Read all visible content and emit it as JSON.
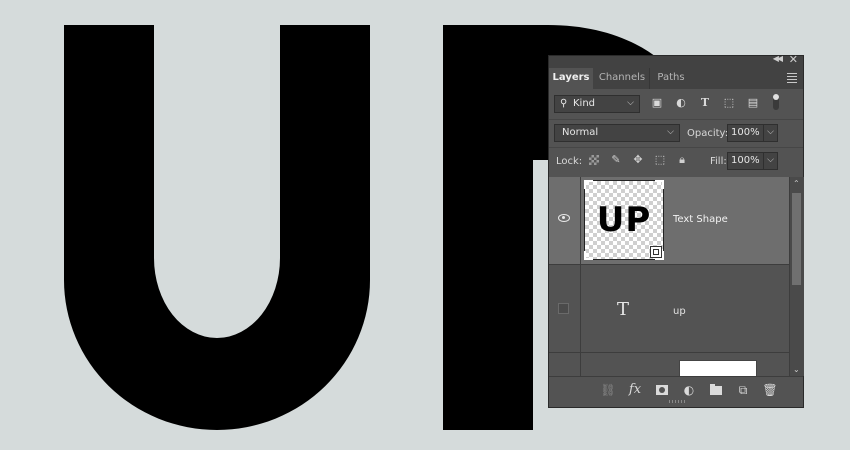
{
  "canvas": {
    "background": "#d5dbdb",
    "letters": [
      "U",
      "P"
    ],
    "letter_color": "#000000"
  },
  "panel": {
    "tabs": [
      {
        "label": "Layers",
        "active": true
      },
      {
        "label": "Channels",
        "active": false
      },
      {
        "label": "Paths",
        "active": false
      }
    ],
    "filter": {
      "kind_label": "Kind",
      "icons": [
        "image-filter-icon",
        "adjustment-filter-icon",
        "type-filter-icon",
        "shape-filter-icon",
        "smart-object-filter-icon",
        "filter-toggle"
      ]
    },
    "blend": {
      "mode": "Normal",
      "opacity_label": "Opacity:",
      "opacity_value": "100%"
    },
    "lock": {
      "label": "Lock:",
      "icons": [
        "lock-transparent-pixels-icon",
        "lock-image-pixels-icon",
        "lock-position-icon",
        "lock-artboard-icon",
        "lock-all-icon"
      ],
      "fill_label": "Fill:",
      "fill_value": "100%"
    },
    "layers": [
      {
        "name": "Text Shape",
        "visible": true,
        "selected": true,
        "thumb_text": "UP",
        "type": "smart-object"
      },
      {
        "name": "up",
        "visible": false,
        "selected": false,
        "type": "text",
        "type_glyph": "T"
      },
      {
        "name": "",
        "visible": false,
        "selected": false,
        "type": "fill"
      }
    ],
    "bottom_icons": [
      "link-layers-icon",
      "layer-style-fx-icon",
      "add-mask-icon",
      "adjustment-layer-icon",
      "new-group-folder-icon",
      "new-layer-icon",
      "delete-layer-icon"
    ],
    "bottom_fx_glyph": "fx"
  }
}
